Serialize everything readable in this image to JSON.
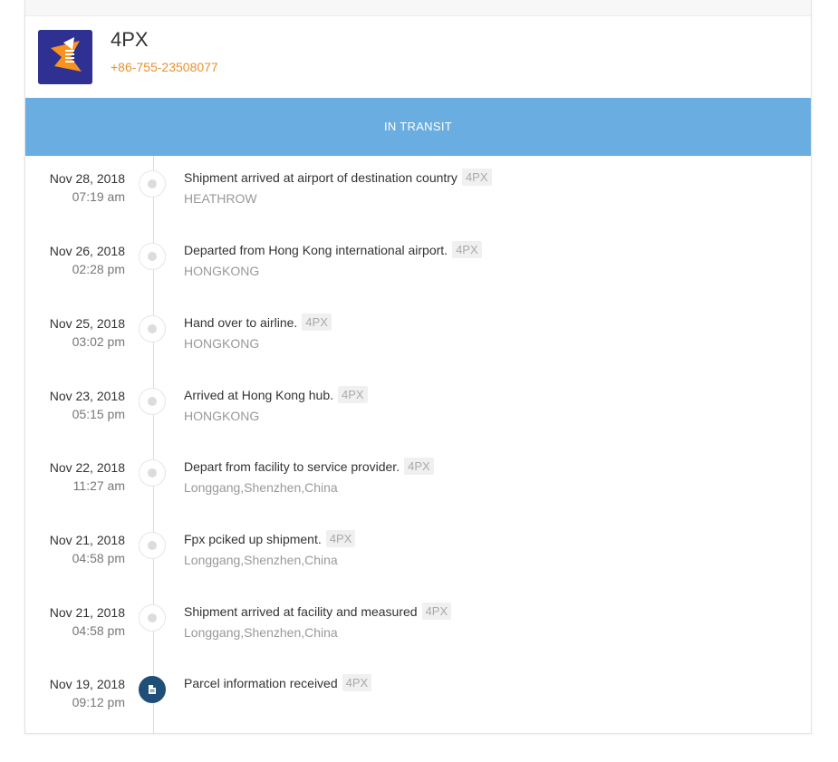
{
  "carrier": {
    "name": "4PX",
    "phone": "+86-755-23508077",
    "brand_color": "#2e3192",
    "accent_color": "#f7931e"
  },
  "status": {
    "label": "IN TRANSIT",
    "color": "#6aade0"
  },
  "events": [
    {
      "date": "Nov 28, 2018",
      "time": "07:19 am",
      "desc": "Shipment arrived at airport of destination country",
      "tag": "4PX",
      "location": "HEATHROW"
    },
    {
      "date": "Nov 26, 2018",
      "time": "02:28 pm",
      "desc": "Departed from Hong Kong international airport.",
      "tag": "4PX",
      "location": "HONGKONG"
    },
    {
      "date": "Nov 25, 2018",
      "time": "03:02 pm",
      "desc": "Hand over to airline.",
      "tag": "4PX",
      "location": "HONGKONG"
    },
    {
      "date": "Nov 23, 2018",
      "time": "05:15 pm",
      "desc": "Arrived at Hong Kong hub.",
      "tag": "4PX",
      "location": "HONGKONG"
    },
    {
      "date": "Nov 22, 2018",
      "time": "11:27 am",
      "desc": "Depart from facility to service provider.",
      "tag": "4PX",
      "location": "Longgang,Shenzhen,China"
    },
    {
      "date": "Nov 21, 2018",
      "time": "04:58 pm",
      "desc": "Fpx pciked up shipment.",
      "tag": "4PX",
      "location": "Longgang,Shenzhen,China"
    },
    {
      "date": "Nov 21, 2018",
      "time": "04:58 pm",
      "desc": "Shipment arrived at facility and measured",
      "tag": "4PX",
      "location": "Longgang,Shenzhen,China"
    },
    {
      "date": "Nov 19, 2018",
      "time": "09:12 pm",
      "desc": "Parcel information received",
      "tag": "4PX",
      "location": ""
    }
  ],
  "icons": {
    "event_dot": "timeline-dot-icon",
    "final_event": "document-icon"
  }
}
